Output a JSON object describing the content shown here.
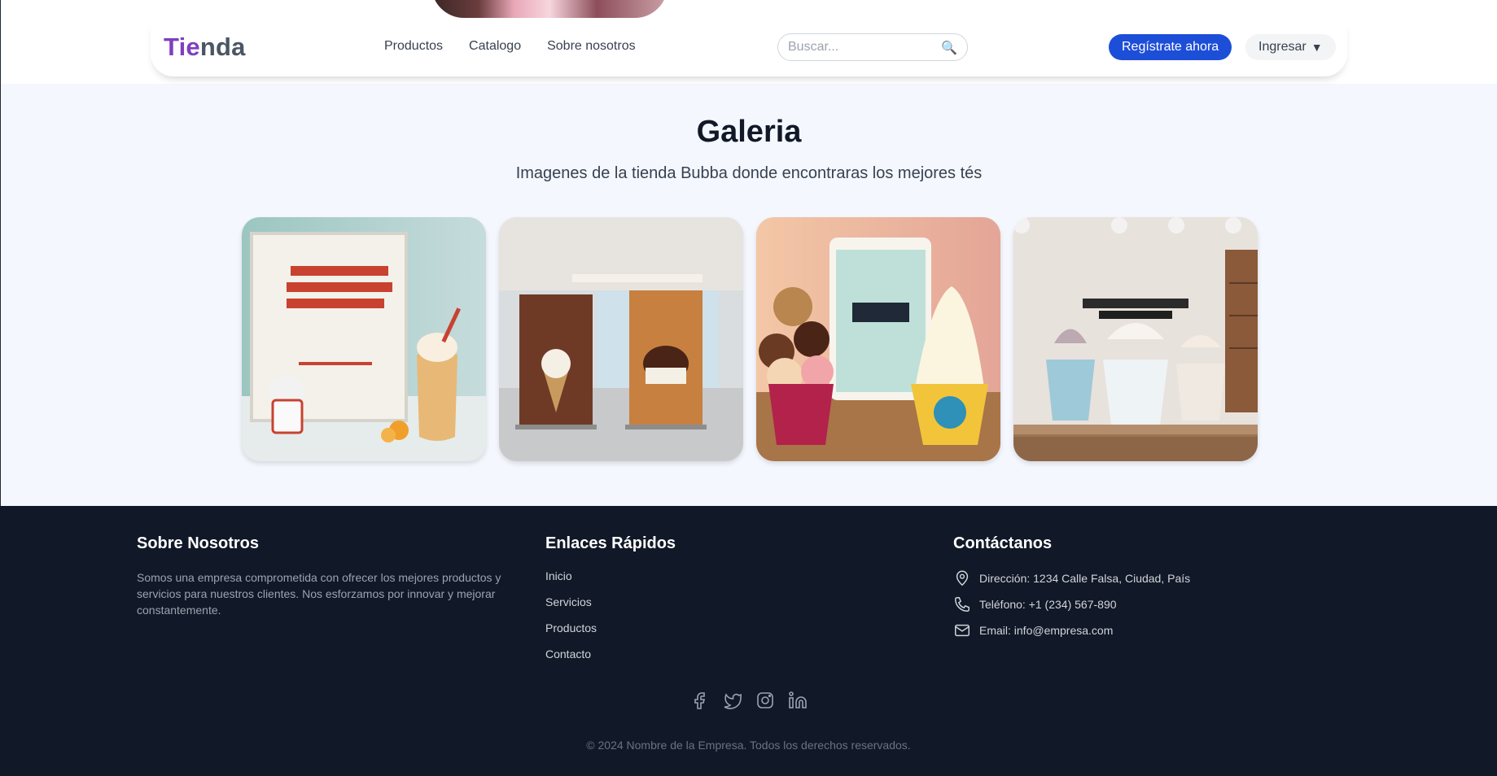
{
  "header": {
    "logo_part1": "Tie",
    "logo_part2": "nda",
    "nav": [
      "Productos",
      "Catalogo",
      "Sobre nosotros"
    ],
    "search_placeholder": "Buscar...",
    "search_icon": "search-icon",
    "register_label": "Regístrate ahora",
    "login_label": "Ingresar",
    "login_caret": "▼"
  },
  "gallery": {
    "title": "Galeria",
    "subtitle": "Imagenes de la tienda Bubba donde encontraras los mejores tés"
  },
  "footer": {
    "about": {
      "title": "Sobre Nosotros",
      "text": "Somos una empresa comprometida con ofrecer los mejores productos y servicios para nuestros clientes. Nos esforzamos por innovar y mejorar constantemente."
    },
    "links": {
      "title": "Enlaces Rápidos",
      "items": [
        "Inicio",
        "Servicios",
        "Productos",
        "Contacto"
      ]
    },
    "contact": {
      "title": "Contáctanos",
      "address": "Dirección: 1234 Calle Falsa, Ciudad, País",
      "phone": "Teléfono: +1 (234) 567-890",
      "email": "Email: info@empresa.com"
    },
    "social_icons": [
      "facebook-icon",
      "twitter-icon",
      "instagram-icon",
      "linkedin-icon"
    ],
    "copyright": "© 2024 Nombre de la Empresa. Todos los derechos reservados."
  },
  "colors": {
    "brand_purple": "#7e3fbf",
    "primary_blue": "#1d4ed8",
    "footer_bg": "#111827",
    "gallery_bg": "#f4f7fd"
  }
}
